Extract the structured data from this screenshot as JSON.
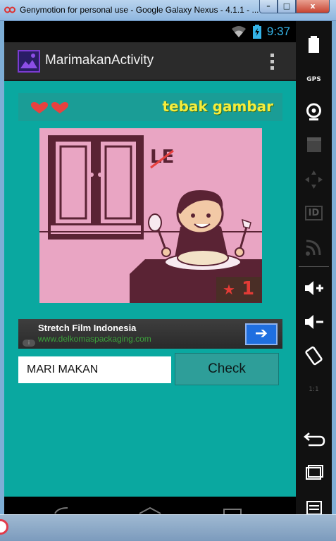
{
  "window": {
    "title": "Genymotion for personal use - Google Galaxy Nexus - 4.1.1 - ...",
    "minimize": "–",
    "maximize": "□",
    "close": "x"
  },
  "status_bar": {
    "time": "9:37"
  },
  "action_bar": {
    "title": "MarimakanActivity"
  },
  "game": {
    "banner_title": "tebak gambar",
    "lives": 2,
    "puzzle_word": "LE",
    "score": "1"
  },
  "ad": {
    "title": "Stretch Film Indonesia",
    "url": "www.delkomaspackaging.com",
    "info": "i"
  },
  "form": {
    "answer_value": "MARI MAKAN",
    "check_label": "Check"
  },
  "side_panel": {
    "gps_label": "GPS",
    "id_label": "ID",
    "ratio_label": "1:1"
  },
  "colors": {
    "content_bg": "#0aa8a0",
    "banner_bg": "#1a9d96",
    "banner_text": "#f5ec3c",
    "puzzle_bg": "#e9a5c3",
    "status_time": "#35b4e8"
  }
}
